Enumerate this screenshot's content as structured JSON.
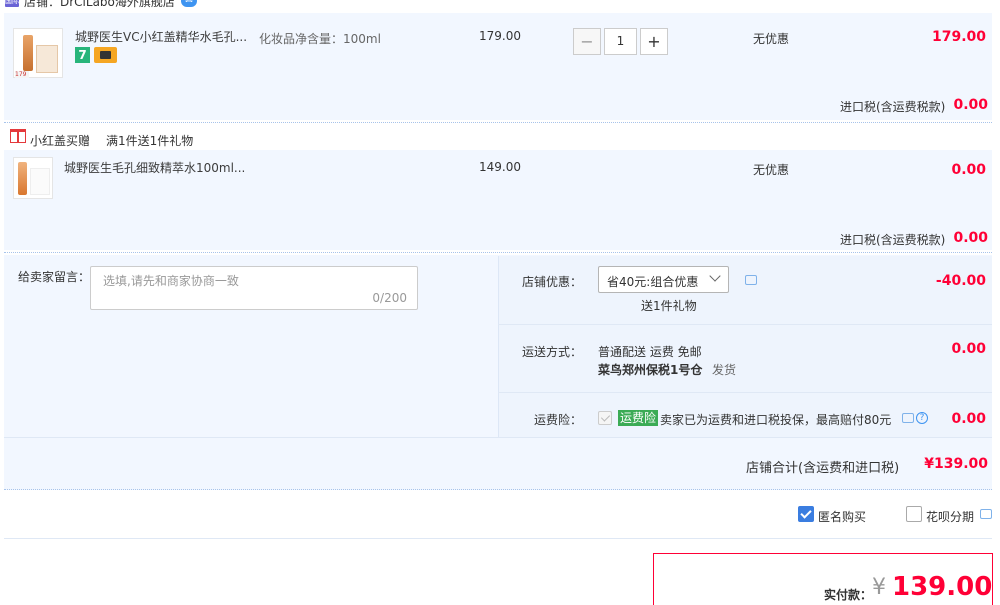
{
  "shop": {
    "icon_text": "国际",
    "name": "店铺：DrCiLabo海外旗舰店"
  },
  "item1": {
    "title": "城野医生VC小红盖精华水毛孔...",
    "sku": "化妆品净含量：100ml",
    "badge": "7",
    "unit_price": "179.00",
    "quantity": "1",
    "minus": "−",
    "plus": "+",
    "promo": "无优惠",
    "subtotal": "179.00",
    "tax_label": "进口税(含运费税款)",
    "tax_value": "0.00"
  },
  "gift": {
    "tag": "小红盖买赠",
    "desc": "满1件送1件礼物"
  },
  "item2": {
    "title": "城野医生毛孔细致精萃水100ml...",
    "unit_price": "149.00",
    "promo": "无优惠",
    "subtotal": "0.00",
    "tax_label": "进口税(含运费税款)",
    "tax_value": "0.00"
  },
  "message": {
    "label": "给卖家留言：",
    "placeholder": "选填,请先和商家协商一致",
    "count": "0/200"
  },
  "shop_promo": {
    "label": "店铺优惠：",
    "selected": "省40元:组合优惠",
    "note": "送1件礼物",
    "value": "-40.00"
  },
  "shipping": {
    "label": "运送方式：",
    "method": "普通配送 运费 免邮",
    "warehouse": "菜鸟郑州保税1号仓",
    "ship_from": "发货",
    "value": "0.00"
  },
  "insurance": {
    "label": "运费险：",
    "tag": "运费险",
    "desc": "卖家已为运费和进口税投保，最高赔付80元",
    "help": "?",
    "value": "0.00"
  },
  "summary": {
    "label": "店铺合计(含运费和进口税)",
    "value": "¥139.00"
  },
  "options": {
    "anonymous": "匿名购买",
    "huabei": "花呗分期"
  },
  "payment": {
    "label": "实付款：",
    "currency": "¥",
    "value": "139.00"
  }
}
